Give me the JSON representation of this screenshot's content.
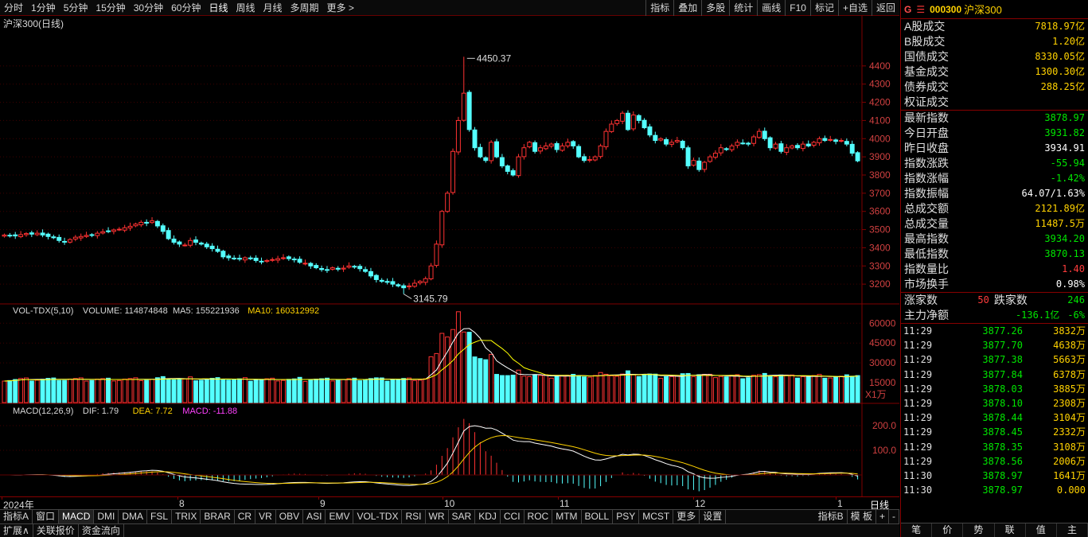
{
  "topbar": {
    "periods": [
      "分时",
      "1分钟",
      "5分钟",
      "15分钟",
      "30分钟",
      "60分钟",
      "日线",
      "周线",
      "月线",
      "多周期",
      "更多 >"
    ],
    "selected": "日线",
    "tools": [
      "指标",
      "叠加",
      "多股",
      "统计",
      "画线",
      "F10",
      "标记",
      "+自选",
      "返回"
    ]
  },
  "chart": {
    "title": "沪深300(日线)",
    "price_ticks": [
      "4400",
      "4300",
      "4200",
      "4100",
      "4000",
      "3900",
      "3800",
      "3700",
      "3600",
      "3500",
      "3400",
      "3300",
      "3200"
    ],
    "high_label": "4450.37",
    "low_label": "3145.79",
    "vol_header": {
      "name": "VOL-TDX(5,10)",
      "volume": "VOLUME: 114874848",
      "ma5": "MA5: 155221936",
      "ma10": "MA10: 160312992"
    },
    "vol_ticks": [
      "60000",
      "45000",
      "30000",
      "15000"
    ],
    "vol_unit": "X1万",
    "macd_header": {
      "name": "MACD(12,26,9)",
      "dif": "DIF: 1.79",
      "dea": "DEA: 7.72",
      "macd": "MACD: -11.88"
    },
    "macd_ticks": [
      "200.0",
      "100.0"
    ],
    "x_labels": [
      "2024年",
      "8",
      "9",
      "10",
      "11",
      "12",
      "1"
    ],
    "period_label": "日线"
  },
  "chart_data": {
    "type": "candlestick",
    "title": "沪深300(日线)",
    "ylim": [
      3100,
      4500
    ],
    "max": 4450.37,
    "min": 3145.79,
    "closes": [
      3470,
      3468,
      3465,
      3472,
      3478,
      3475,
      3480,
      3470,
      3462,
      3455,
      3440,
      3432,
      3445,
      3458,
      3462,
      3468,
      3470,
      3480,
      3488,
      3492,
      3498,
      3502,
      3510,
      3518,
      3530,
      3540,
      3535,
      3548,
      3520,
      3490,
      3450,
      3430,
      3420,
      3415,
      3440,
      3430,
      3420,
      3405,
      3395,
      3380,
      3350,
      3345,
      3340,
      3338,
      3345,
      3340,
      3330,
      3325,
      3330,
      3335,
      3340,
      3345,
      3340,
      3335,
      3320,
      3315,
      3300,
      3290,
      3280,
      3278,
      3290,
      3282,
      3288,
      3300,
      3296,
      3285,
      3270,
      3245,
      3225,
      3215,
      3210,
      3200,
      3190,
      3180,
      3190,
      3205,
      3215,
      3230,
      3300,
      3420,
      3600,
      3700,
      3930,
      4100,
      4250,
      4050,
      3950,
      3900,
      3880,
      3980,
      3900,
      3850,
      3820,
      3800,
      3900,
      3950,
      3980,
      3930,
      3950,
      3960,
      3970,
      3940,
      3960,
      3980,
      3960,
      3900,
      3880,
      3885,
      3900,
      3960,
      4040,
      4080,
      4100,
      4140,
      4050,
      4130,
      4100,
      4060,
      4020,
      3990,
      4000,
      3970,
      3980,
      3990,
      3950,
      3850,
      3880,
      3830,
      3870,
      3900,
      3920,
      3950,
      3940,
      3960,
      3980,
      3975,
      3970,
      4010,
      4040,
      4000,
      3950,
      3970,
      3930,
      3950,
      3960,
      3950,
      3970,
      3960,
      3980,
      4000,
      3990,
      3995,
      3985,
      3990,
      3970,
      3920,
      3878
    ]
  },
  "side": {
    "header": {
      "g": "G",
      "code": "000300",
      "name": "沪深300"
    },
    "market": [
      {
        "label": "A股成交",
        "value": "7818.97亿",
        "cls": "y"
      },
      {
        "label": "B股成交",
        "value": "1.20亿",
        "cls": "y"
      },
      {
        "label": "国债成交",
        "value": "8330.05亿",
        "cls": "y"
      },
      {
        "label": "基金成交",
        "value": "1300.30亿",
        "cls": "y"
      },
      {
        "label": "债券成交",
        "value": "288.25亿",
        "cls": "y"
      },
      {
        "label": "权证成交",
        "value": "",
        "cls": "y"
      }
    ],
    "quote": [
      {
        "label": "最新指数",
        "value": "3878.97",
        "cls": "g1"
      },
      {
        "label": "今日开盘",
        "value": "3931.82",
        "cls": "g1"
      },
      {
        "label": "昨日收盘",
        "value": "3934.91",
        "cls": "w"
      },
      {
        "label": "指数涨跌",
        "value": "-55.94",
        "cls": "g1"
      },
      {
        "label": "指数涨幅",
        "value": "-1.42%",
        "cls": "g1"
      },
      {
        "label": "指数振幅",
        "value": "64.07/1.63%",
        "cls": "w"
      },
      {
        "label": "总成交额",
        "value": "2121.89亿",
        "cls": "y"
      },
      {
        "label": "总成交量",
        "value": "11487.5万",
        "cls": "y"
      },
      {
        "label": "最高指数",
        "value": "3934.20",
        "cls": "g1"
      },
      {
        "label": "最低指数",
        "value": "3870.13",
        "cls": "g1"
      },
      {
        "label": "指数量比",
        "value": "1.40",
        "cls": "r1"
      },
      {
        "label": "市场换手",
        "value": "0.98%",
        "cls": "w"
      }
    ],
    "breadth": {
      "up_label": "涨家数",
      "up": "50",
      "down_label": "跌家数",
      "down": "246"
    },
    "flow": {
      "label": "主力净额",
      "value": "-136.1亿",
      "pct": "-6%"
    },
    "ticks": [
      {
        "t": "11:29",
        "p": "3877.26",
        "v": "3832万"
      },
      {
        "t": "11:29",
        "p": "3877.70",
        "v": "4638万"
      },
      {
        "t": "11:29",
        "p": "3877.38",
        "v": "5663万"
      },
      {
        "t": "11:29",
        "p": "3877.84",
        "v": "6378万"
      },
      {
        "t": "11:29",
        "p": "3878.03",
        "v": "3885万"
      },
      {
        "t": "11:29",
        "p": "3878.10",
        "v": "2308万"
      },
      {
        "t": "11:29",
        "p": "3878.44",
        "v": "3104万"
      },
      {
        "t": "11:29",
        "p": "3878.45",
        "v": "2332万"
      },
      {
        "t": "11:29",
        "p": "3878.35",
        "v": "3108万"
      },
      {
        "t": "11:29",
        "p": "3878.56",
        "v": "2006万"
      },
      {
        "t": "11:30",
        "p": "3878.97",
        "v": "1641万"
      },
      {
        "t": "11:30",
        "p": "3878.97",
        "v": "0.000"
      }
    ],
    "bottom_tabs": [
      "笔",
      "价",
      "势",
      "联",
      "值",
      "主"
    ]
  },
  "tabs": [
    "指标A",
    "窗口",
    "MACD",
    "DMI",
    "DMA",
    "FSL",
    "TRIX",
    "BRAR",
    "CR",
    "VR",
    "OBV",
    "ASI",
    "EMV",
    "VOL-TDX",
    "RSI",
    "WR",
    "SAR",
    "KDJ",
    "CCI",
    "ROC",
    "MTM",
    "BOLL",
    "PSY",
    "MCST",
    "更多",
    "设置"
  ],
  "tabs_right": [
    "指标B",
    "模 板",
    "+",
    "-"
  ],
  "tabs2": [
    "扩展∧",
    "关联报价",
    "资金流向"
  ],
  "colors": {
    "up": "#ff3232",
    "down": "#54ffff",
    "ma5": "#ffffff",
    "ma10": "#ffff00",
    "grid": "#800000"
  }
}
